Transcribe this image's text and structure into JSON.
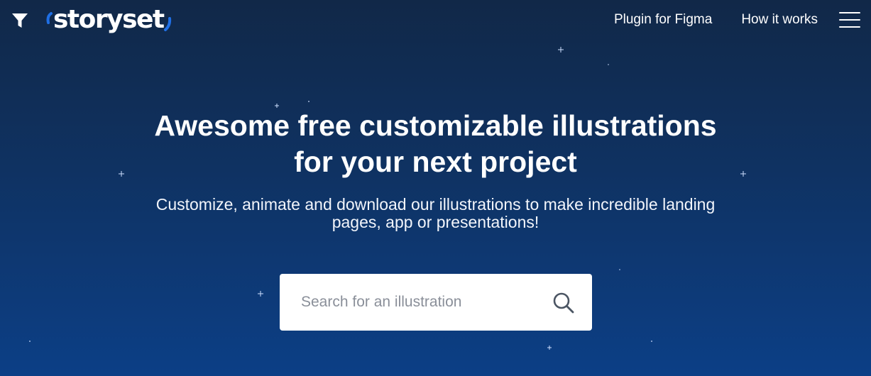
{
  "header": {
    "filter_icon": "filter-icon",
    "logo_text": "storyset",
    "nav": [
      {
        "label": "Plugin for Figma"
      },
      {
        "label": "How it works"
      }
    ],
    "menu_icon": "hamburger-menu-icon"
  },
  "hero": {
    "headline": "Awesome free customizable illustrations\nfor your next project",
    "subtitle": "Customize, animate and download our illustrations to make incredible landing\npages, app or presentations!"
  },
  "search": {
    "placeholder": "Search for an illustration",
    "value": "",
    "icon": "search-icon"
  },
  "colors": {
    "background_top": "#112848",
    "background_bottom": "#0c3f86",
    "brand_accent": "#1f6fe5"
  }
}
